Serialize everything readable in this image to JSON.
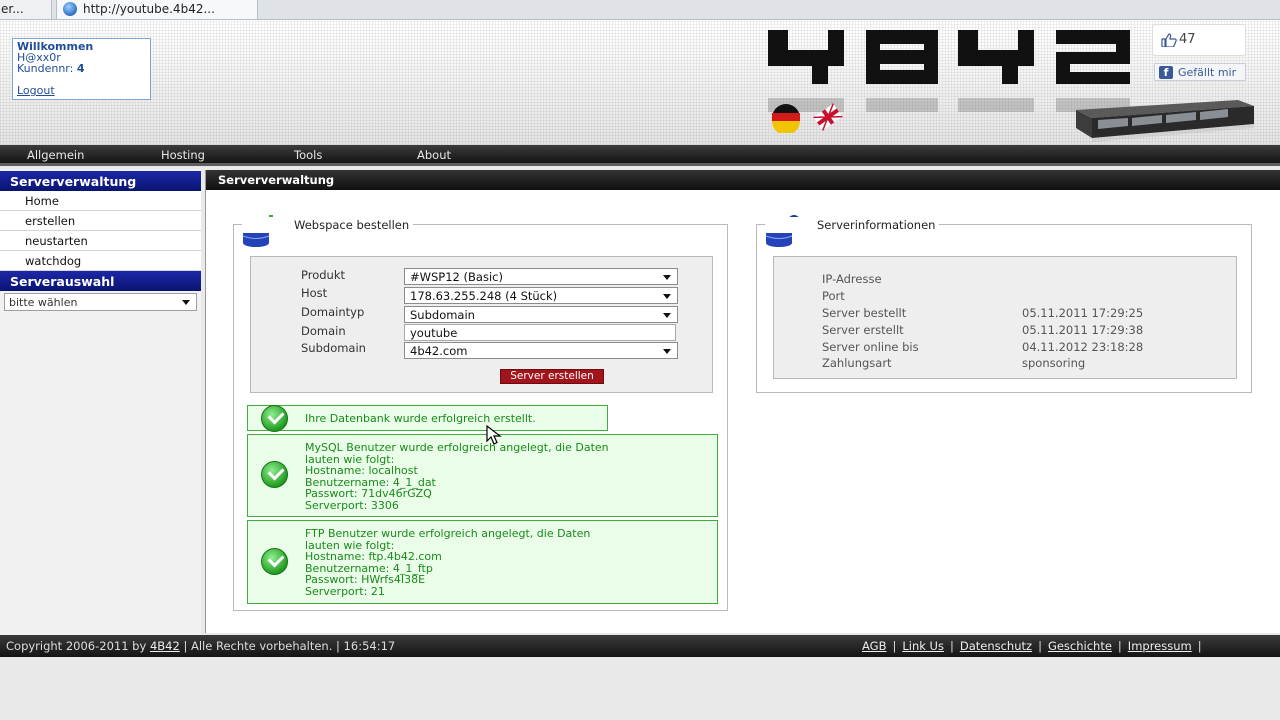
{
  "browser": {
    "tab_prev_label": "er...",
    "tab_active_label": "http://youtube.4b42..."
  },
  "header": {
    "welcome_title": "Willkommen",
    "username": "H@xx0r",
    "customer_label": "Kundennr:",
    "customer_number": "4",
    "logout_label": "Logout",
    "facebook_like_count": "47",
    "facebook_like_label": "Gefällt mir"
  },
  "nav": {
    "items": [
      "Allgemein",
      "Hosting",
      "Tools",
      "About"
    ]
  },
  "sidebar": {
    "section1_title": "Serververwaltung",
    "items": [
      "Home",
      "erstellen",
      "neustarten",
      "watchdog"
    ],
    "section2_title": "Serverauswahl",
    "select_value": "bitte wählen"
  },
  "content": {
    "title": "Serververwaltung",
    "order": {
      "legend": "Webspace bestellen",
      "fields": [
        {
          "label": "Produkt",
          "value": "#WSP12 (Basic)"
        },
        {
          "label": "Host",
          "value": "178.63.255.248 (4 Stück)"
        },
        {
          "label": "Domaintyp",
          "value": "Subdomain"
        },
        {
          "label": "Domain",
          "value": "youtube"
        },
        {
          "label": "Subdomain",
          "value": "4b42.com"
        }
      ],
      "submit_label": "Server erstellen"
    },
    "messages": {
      "db_created": "Ihre Datenbank wurde erfolgreich erstellt.",
      "mysql_lines": [
        "MySQL Benutzer wurde erfolgreich angelegt, die Daten",
        "lauten wie folgt:",
        "Hostname: localhost",
        "Benutzername: 4_1_dat",
        "Passwort: 71dv46rGZQ",
        "Serverport: 3306"
      ],
      "ftp_lines": [
        "FTP Benutzer wurde erfolgreich angelegt, die Daten",
        "lauten wie folgt:",
        "Hostname: ftp.4b42.com",
        "Benutzername: 4_1_ftp",
        "Passwort: HWrfs4I38E",
        "Serverport: 21"
      ]
    },
    "info": {
      "legend": "Serverinformationen",
      "rows": [
        {
          "label": "IP-Adresse",
          "value": ""
        },
        {
          "label": "Port",
          "value": ""
        },
        {
          "label": "Server bestellt",
          "value": "05.11.2011 17:29:25"
        },
        {
          "label": "Server erstellt",
          "value": "05.11.2011 17:29:38"
        },
        {
          "label": "Server online bis",
          "value": "04.11.2012 23:18:28"
        },
        {
          "label": "Zahlungsart",
          "value": "sponsoring"
        }
      ]
    }
  },
  "footer": {
    "copyright_prefix": "Copyright 2006-2011 by",
    "brand_link": "4B42",
    "rights_text": "| Alle Rechte vorbehalten. | 16:54:17",
    "links": [
      "AGB",
      "Link Us",
      "Datenschutz",
      "Geschichte",
      "Impressum"
    ]
  },
  "colors": {
    "sidebar_header": "#0a1470",
    "success_green": "#1a8a1a",
    "submit_red": "#a1141b"
  }
}
